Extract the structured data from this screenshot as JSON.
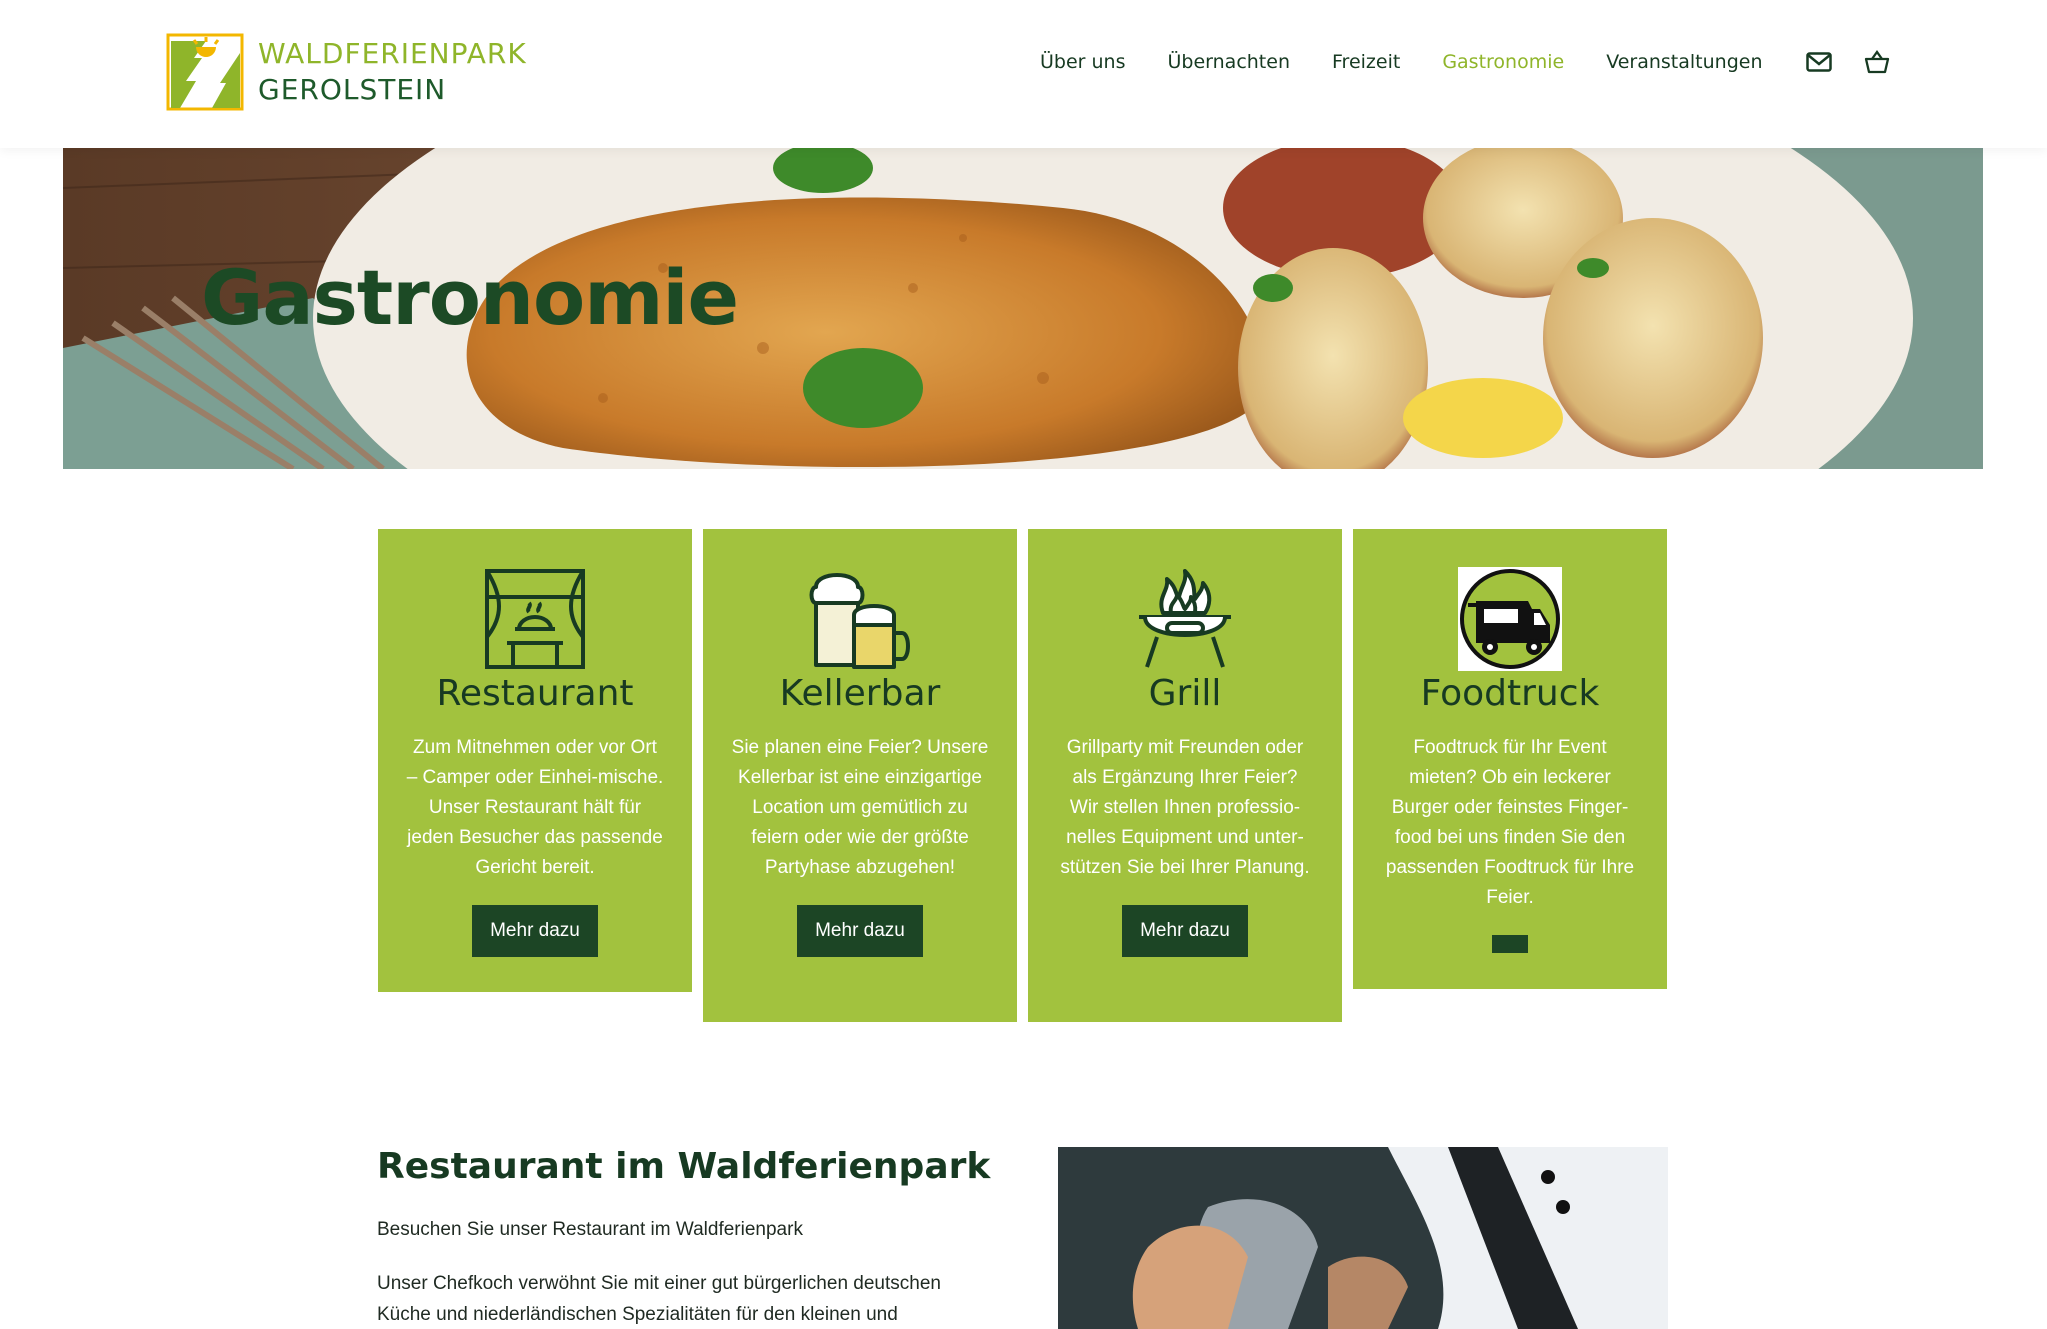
{
  "brand": {
    "name_line1": "WALDFERIENPARK",
    "name_line2": "GEROLSTEIN",
    "colors": {
      "accent": "#a2c23e",
      "dark": "#1c4525",
      "logo_green": "#8fb52a",
      "sun": "#f3b700"
    }
  },
  "nav": {
    "items": [
      {
        "label": "Über uns",
        "active": false
      },
      {
        "label": "Übernachten",
        "active": false
      },
      {
        "label": "Freizeit",
        "active": false
      },
      {
        "label": "Gastronomie",
        "active": true
      },
      {
        "label": "Veranstaltungen",
        "active": false
      }
    ],
    "icons": [
      "mail-icon",
      "cart-icon"
    ]
  },
  "hero": {
    "title": "Gastronomie"
  },
  "cards": [
    {
      "icon": "restaurant-icon",
      "title": "Restaurant",
      "text": "Zum Mitnehmen oder vor Ort – Camper oder Einhei-mische. Unser Restaurant hält für jeden Besucher das passende Gericht bereit.",
      "button": "Mehr dazu"
    },
    {
      "icon": "beer-mugs-icon",
      "title": "Kellerbar",
      "text": "Sie planen eine Feier? Unsere Kellerbar ist eine einzigartige Location um gemütlich zu feiern oder wie der größte Partyhase abzugehen!",
      "button": "Mehr dazu"
    },
    {
      "icon": "grill-icon",
      "title": "Grill",
      "text": "Grillparty mit Freunden oder als Ergänzung Ihrer Feier? Wir stellen Ihnen professio-nelles Equipment und unter-stützen Sie bei Ihrer Planung.",
      "button": "Mehr dazu"
    },
    {
      "icon": "foodtruck-icon",
      "title": "Foodtruck",
      "text": "Foodtruck für Ihr Event mieten? Ob ein leckerer Burger oder feinstes Finger-food bei uns finden Sie den passenden Foodtruck für Ihre Feier.",
      "button": ""
    }
  ],
  "restaurant_section": {
    "title": "Restaurant im Waldferienpark",
    "subtitle": "Besuchen Sie unser Restaurant im Waldferienpark",
    "body": "Unser Chefkoch verwöhnt Sie mit einer gut bürgerlichen deutschen Küche und niederländischen Spezialitäten für den kleinen und"
  }
}
